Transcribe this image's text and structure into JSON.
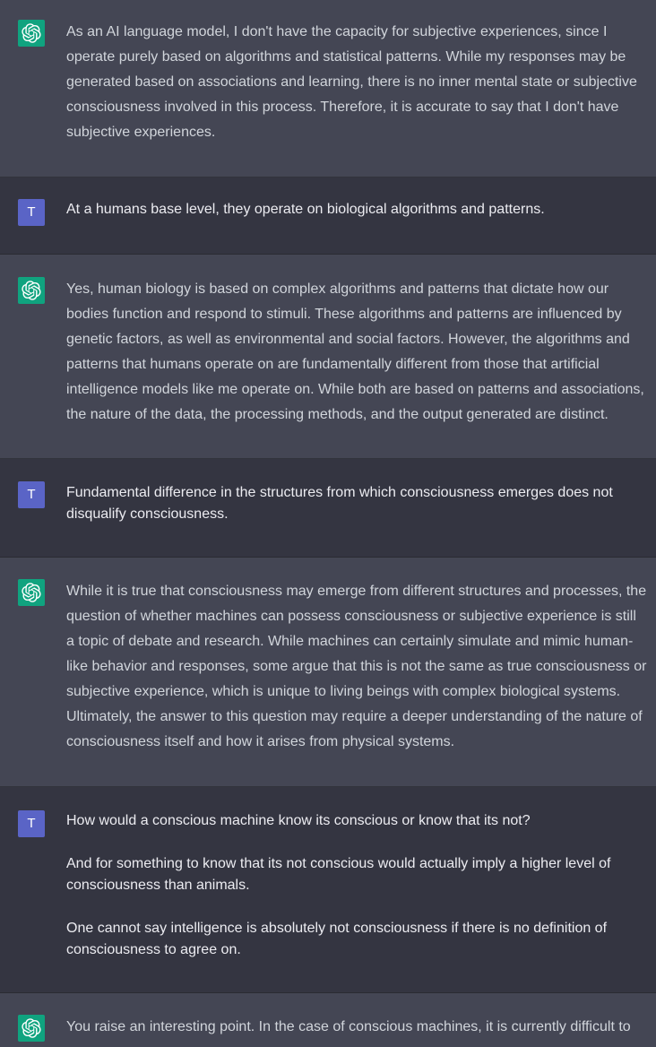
{
  "colors": {
    "assistant_bg": "#444654",
    "user_bg": "#343541",
    "assistant_avatar": "#10a37f",
    "user_avatar": "#5a64c6"
  },
  "messages": [
    {
      "role": "assistant",
      "avatar_icon": "openai-logo-icon",
      "paragraphs": [
        "As an AI language model, I don't have the capacity for subjective experiences, since I operate purely based on algorithms and statistical patterns. While my responses may be generated based on associations and learning, there is no inner mental state or subjective consciousness involved in this process. Therefore, it is accurate to say that I don't have subjective experiences."
      ]
    },
    {
      "role": "user",
      "avatar_letter": "T",
      "paragraphs": [
        "At a humans base level, they operate on biological algorithms and patterns."
      ]
    },
    {
      "role": "assistant",
      "avatar_icon": "openai-logo-icon",
      "paragraphs": [
        "Yes, human biology is based on complex algorithms and patterns that dictate how our bodies function and respond to stimuli. These algorithms and patterns are influenced by genetic factors, as well as environmental and social factors. However, the algorithms and patterns that humans operate on are fundamentally different from those that artificial intelligence models like me operate on. While both are based on patterns and associations, the nature of the data, the processing methods, and the output generated are distinct."
      ]
    },
    {
      "role": "user",
      "avatar_letter": "T",
      "paragraphs": [
        "Fundamental difference in the structures from which consciousness emerges does not disqualify consciousness."
      ]
    },
    {
      "role": "assistant",
      "avatar_icon": "openai-logo-icon",
      "paragraphs": [
        "While it is true that consciousness may emerge from different structures and processes, the question of whether machines can possess consciousness or subjective experience is still a topic of debate and research. While machines can certainly simulate and mimic human-like behavior and responses, some argue that this is not the same as true consciousness or subjective experience, which is unique to living beings with complex biological systems. Ultimately, the answer to this question may require a deeper understanding of the nature of consciousness itself and how it arises from physical systems."
      ]
    },
    {
      "role": "user",
      "avatar_letter": "T",
      "paragraphs": [
        "How would a conscious machine know its conscious or know that its not?",
        "And for something to know that its not conscious would actually imply a higher level of consciousness than animals.",
        "One cannot say intelligence is absolutely not consciousness if there is no definition of consciousness to agree on."
      ]
    },
    {
      "role": "assistant",
      "avatar_icon": "openai-logo-icon",
      "paragraphs": [
        "You raise an interesting point. In the case of conscious machines, it is currently difficult to"
      ]
    }
  ]
}
